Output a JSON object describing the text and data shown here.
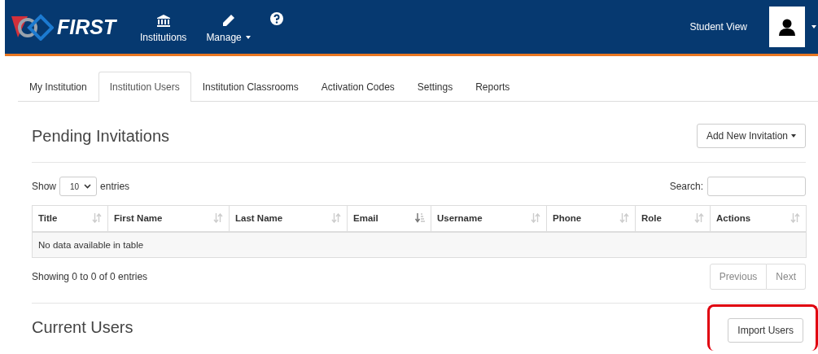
{
  "navbar": {
    "logo": "FIRST",
    "items": [
      {
        "kind": "institution",
        "label": "Institutions",
        "dropdown": false
      },
      {
        "kind": "pencil",
        "label": "Manage",
        "dropdown": true
      },
      {
        "kind": "help",
        "dropdown": false
      }
    ],
    "student_view": "Student View"
  },
  "tabs": [
    {
      "label": "My Institution",
      "selected": false
    },
    {
      "label": "Institution Users",
      "selected": true
    },
    {
      "label": "Institution Classrooms",
      "selected": false
    },
    {
      "label": "Activation Codes",
      "selected": false
    },
    {
      "label": "Settings",
      "selected": false
    },
    {
      "label": "Reports",
      "selected": false
    }
  ],
  "pending": {
    "title": "Pending Invitations",
    "add_button": "Add New Invitation",
    "show_label": "Show",
    "page_size": "10",
    "entries_label": "entries",
    "search_label": "Search:",
    "columns": [
      {
        "label": "Title",
        "sorted": false
      },
      {
        "label": "First Name",
        "sorted": false
      },
      {
        "label": "Last Name",
        "sorted": false
      },
      {
        "label": "Email",
        "sorted": true
      },
      {
        "label": "Username",
        "sorted": false
      },
      {
        "label": "Phone",
        "sorted": false
      },
      {
        "label": "Role",
        "sorted": false
      },
      {
        "label": "Actions",
        "sorted": false
      }
    ],
    "empty_message": "No data available in table",
    "info": "Showing 0 to 0 of 0 entries",
    "pagination": [
      {
        "label": "Previous",
        "disabled": true
      },
      {
        "label": "Next",
        "disabled": true
      }
    ]
  },
  "current": {
    "title": "Current Users",
    "import_button": {
      "label": "Import Users",
      "highlighted": true
    }
  }
}
